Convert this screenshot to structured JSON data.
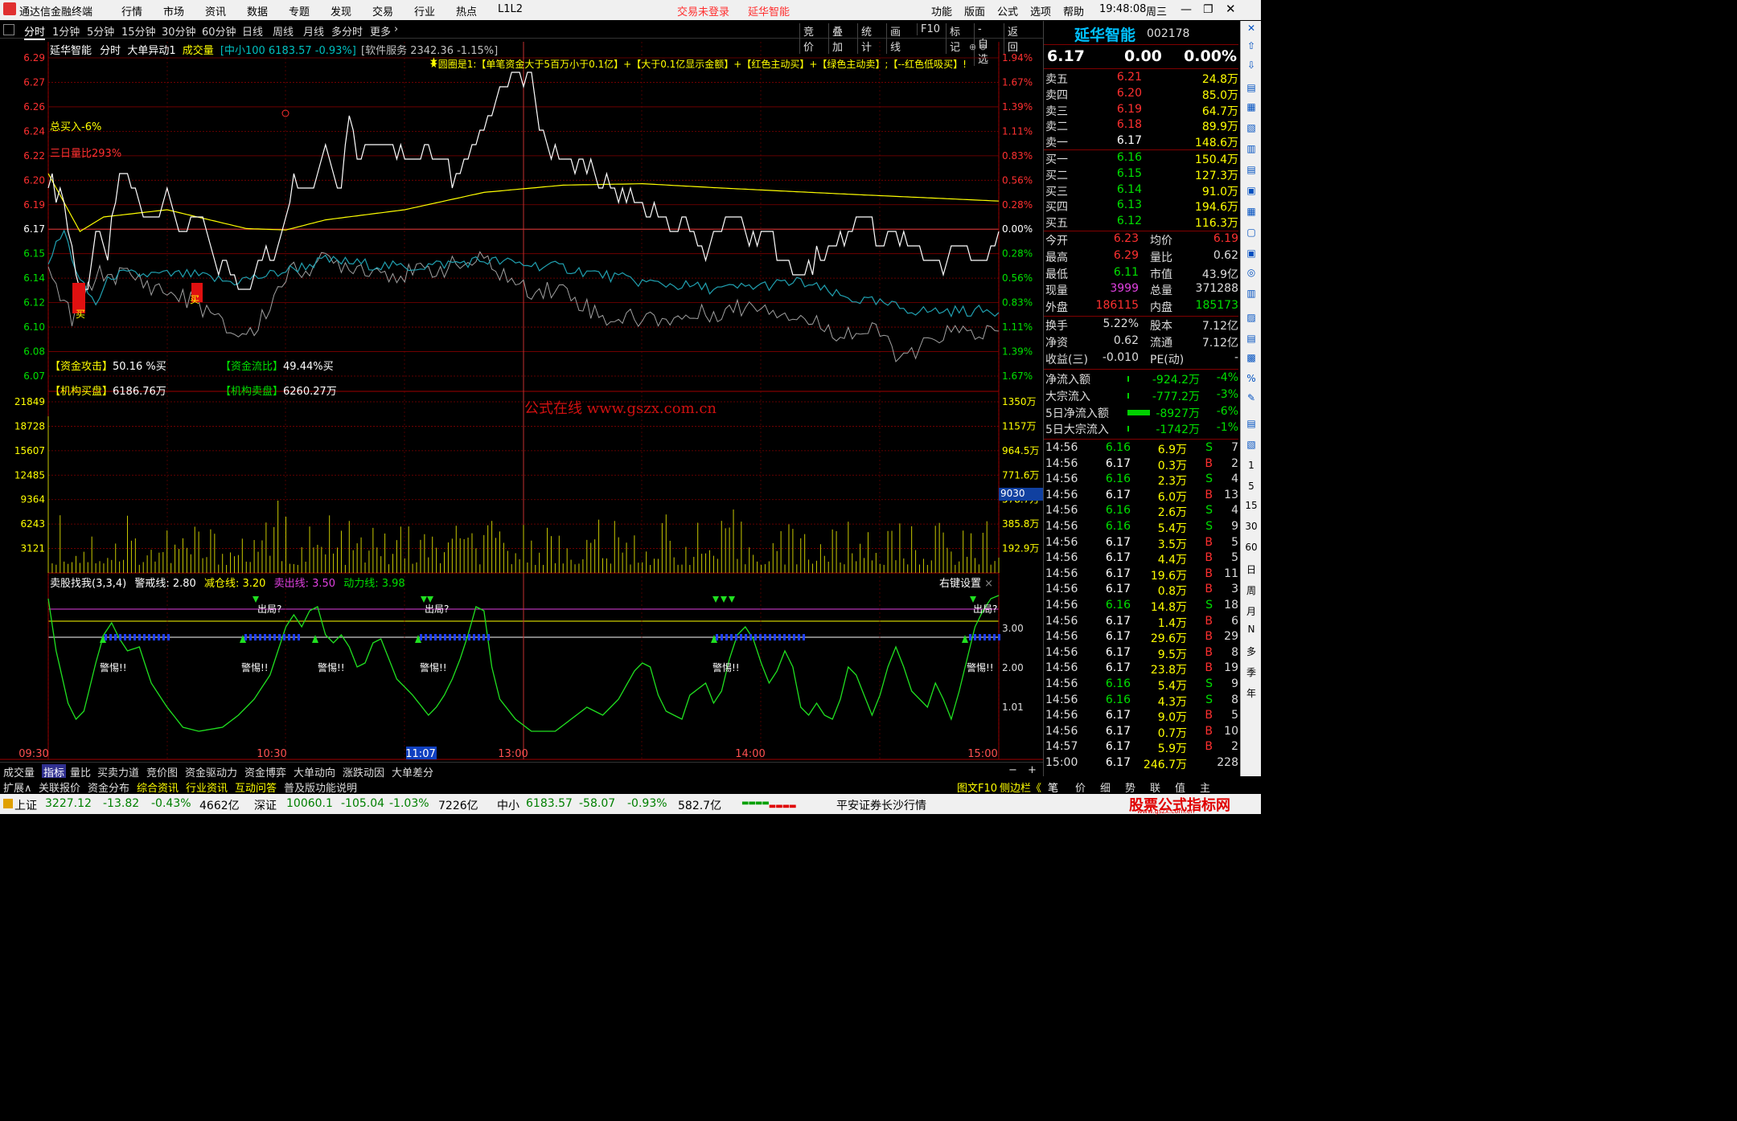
{
  "menu": {
    "app": "通达信金融终端",
    "items": [
      "行情",
      "市场",
      "资讯",
      "数据",
      "专题",
      "发现",
      "交易",
      "行业",
      "热点",
      "L1L2"
    ],
    "trade_status": "交易未登录",
    "stock_title": "延华智能",
    "right": [
      "功能",
      "版面",
      "公式",
      "选项",
      "帮助"
    ],
    "time": "19:48:08",
    "weekday": "周三"
  },
  "periods": [
    "分时",
    "1分钟",
    "5分钟",
    "15分钟",
    "30分钟",
    "60分钟",
    "日线",
    "周线",
    "月线",
    "多分时",
    "更多"
  ],
  "tools": [
    "竞价",
    "叠加",
    "统计",
    "画线",
    "F10",
    "标记",
    "-自选",
    "返回"
  ],
  "chart_head": {
    "name": "延华智能",
    "mode": "分时",
    "formula": "大单异动1",
    "vol": "成交量",
    "idx": "[中小100 6183.57 -0.93%]",
    "sw": "[软件服务 2342.36 -1.15%]"
  },
  "legend_text": "★圆圈是1:【单笔资金大于5百万小于0.1亿】+【大于0.1亿显示金额】+【红色主动买】+【绿色主动卖】;【--红色低吸买】!",
  "annot": {
    "total_buy": "总买入-6%",
    "vol_ratio": "三日量比293%",
    "attack_label": "【资金攻击】",
    "attack_val": "50.16 %买",
    "flow_label": "【资金流比】",
    "flow_val": "49.44%买",
    "inst_buy_label": "【机构买盘】",
    "inst_buy_val": "6186.76万",
    "inst_sell_label": "【机构卖盘】",
    "inst_sell_val": "6260.27万",
    "watermark": "公式在线  www.gszx.com.cn",
    "buy_mark": "买"
  },
  "price_left": [
    "6.29",
    "6.27",
    "6.26",
    "6.24",
    "6.22",
    "6.20",
    "6.19",
    "6.17",
    "6.15",
    "6.14",
    "6.12",
    "6.10",
    "6.08",
    "6.07"
  ],
  "pct_right": [
    "1.94%",
    "1.67%",
    "1.39%",
    "1.11%",
    "0.83%",
    "0.56%",
    "0.28%",
    "0.00%",
    "0.28%",
    "0.56%",
    "0.83%",
    "1.11%",
    "1.39%",
    "1.67%"
  ],
  "vol_left": [
    "21849",
    "18728",
    "15607",
    "12485",
    "9364",
    "6243",
    "3121"
  ],
  "vol_right": [
    "1350万",
    "1157万",
    "964.5万",
    "771.6万",
    "578.7万",
    "385.8万",
    "192.9万"
  ],
  "vol_cursor": "9030",
  "ind_head": {
    "name": "卖股找我(3,3,4)",
    "l1": "警戒线: 2.80",
    "l2": "减仓线: 3.20",
    "l3": "卖出线: 3.50",
    "l4": "动力线: 3.98",
    "set": "右键设置"
  },
  "ind_right": [
    "3.00",
    "2.00",
    "1.01"
  ],
  "ind_labels": {
    "out": "出局?",
    "warn": "警惕!!"
  },
  "times": [
    "09:30",
    "10:30",
    "11:07",
    "13:00",
    "14:00",
    "15:00"
  ],
  "quote": {
    "name": "延华智能",
    "code": "002178",
    "price": "6.17",
    "chg": "0.00",
    "pct": "0.00%"
  },
  "asks": [
    {
      "l": "卖五",
      "p": "6.21",
      "v": "24.8万"
    },
    {
      "l": "卖四",
      "p": "6.20",
      "v": "85.0万"
    },
    {
      "l": "卖三",
      "p": "6.19",
      "v": "64.7万"
    },
    {
      "l": "卖二",
      "p": "6.18",
      "v": "89.9万"
    },
    {
      "l": "卖一",
      "p": "6.17",
      "v": "148.6万"
    }
  ],
  "bids": [
    {
      "l": "买一",
      "p": "6.16",
      "v": "150.4万"
    },
    {
      "l": "买二",
      "p": "6.15",
      "v": "127.3万"
    },
    {
      "l": "买三",
      "p": "6.14",
      "v": "91.0万"
    },
    {
      "l": "买四",
      "p": "6.13",
      "v": "194.6万"
    },
    {
      "l": "买五",
      "p": "6.12",
      "v": "116.3万"
    }
  ],
  "stats": [
    {
      "a": "今开",
      "b": "6.23",
      "c": "均价",
      "d": "6.19"
    },
    {
      "a": "最高",
      "b": "6.29",
      "c": "量比",
      "d": "0.62"
    },
    {
      "a": "最低",
      "b": "6.11",
      "c": "市值",
      "d": "43.9亿"
    },
    {
      "a": "现量",
      "b": "3999",
      "c": "总量",
      "d": "371288"
    },
    {
      "a": "外盘",
      "b": "186115",
      "c": "内盘",
      "d": "185173"
    }
  ],
  "stats2": [
    {
      "a": "换手",
      "b": "5.22%",
      "c": "股本",
      "d": "7.12亿"
    },
    {
      "a": "净资",
      "b": "0.62",
      "c": "流通",
      "d": "7.12亿"
    },
    {
      "a": "收益(三)",
      "b": "-0.010",
      "c": "PE(动)",
      "d": "-"
    }
  ],
  "flows": [
    {
      "a": "净流入额",
      "b": "-924.2万",
      "c": "-4%"
    },
    {
      "a": "大宗流入",
      "b": "-777.2万",
      "c": "-3%"
    },
    {
      "a": "5日净流入额",
      "b": "-8927万",
      "c": "-6%"
    },
    {
      "a": "5日大宗流入",
      "b": "-1742万",
      "c": "-1%"
    }
  ],
  "ticks": [
    [
      "14:56",
      "6.16",
      "6.9万",
      "S",
      "7"
    ],
    [
      "14:56",
      "6.17",
      "0.3万",
      "B",
      "2"
    ],
    [
      "14:56",
      "6.16",
      "2.3万",
      "S",
      "4"
    ],
    [
      "14:56",
      "6.17",
      "6.0万",
      "B",
      "13"
    ],
    [
      "14:56",
      "6.16",
      "2.6万",
      "S",
      "4"
    ],
    [
      "14:56",
      "6.16",
      "5.4万",
      "S",
      "9"
    ],
    [
      "14:56",
      "6.17",
      "3.5万",
      "B",
      "5"
    ],
    [
      "14:56",
      "6.17",
      "4.4万",
      "B",
      "5"
    ],
    [
      "14:56",
      "6.17",
      "19.6万",
      "B",
      "11"
    ],
    [
      "14:56",
      "6.17",
      "0.8万",
      "B",
      "3"
    ],
    [
      "14:56",
      "6.16",
      "14.8万",
      "S",
      "18"
    ],
    [
      "14:56",
      "6.17",
      "1.4万",
      "B",
      "6"
    ],
    [
      "14:56",
      "6.17",
      "29.6万",
      "B",
      "29"
    ],
    [
      "14:56",
      "6.17",
      "9.5万",
      "B",
      "8"
    ],
    [
      "14:56",
      "6.17",
      "23.8万",
      "B",
      "19"
    ],
    [
      "14:56",
      "6.16",
      "5.4万",
      "S",
      "9"
    ],
    [
      "14:56",
      "6.16",
      "4.3万",
      "S",
      "8"
    ],
    [
      "14:56",
      "6.17",
      "9.0万",
      "B",
      "5"
    ],
    [
      "14:56",
      "6.17",
      "0.7万",
      "B",
      "10"
    ],
    [
      "14:57",
      "6.17",
      "5.9万",
      "B",
      "2"
    ],
    [
      "15:00",
      "6.17",
      "246.7万",
      "",
      "228"
    ]
  ],
  "sidebar": [
    "1",
    "5",
    "15",
    "30",
    "60",
    "日",
    "周",
    "月",
    "N",
    "多",
    "季",
    "年"
  ],
  "btabs": [
    "成交量",
    "指标",
    "量比",
    "买卖力道",
    "竞价图",
    "资金驱动力",
    "资金博弈",
    "大单动向",
    "涨跌动因",
    "大单差分"
  ],
  "btabs2": [
    "扩展∧",
    "关联报价",
    "资金分布",
    "综合资讯",
    "行业资讯",
    "互动问答",
    "普及版功能说明"
  ],
  "btabs2_right": [
    "图文F10",
    "侧边栏《",
    "笔",
    "价",
    "细",
    "势",
    "联",
    "值",
    "主"
  ],
  "status": {
    "sh": "上证",
    "sh_v": "3227.12",
    "sh_c": "-13.82",
    "sh_p": "-0.43%",
    "sh_a": "4662亿",
    "sz": "深证",
    "sz_v": "10060.1",
    "sz_c": "-105.04",
    "sz_p": "-1.03%",
    "sz_a": "7226亿",
    "zx": "中小",
    "zx_v": "6183.57",
    "zx_c": "-58.07",
    "zx_p": "-0.93%",
    "zx_a": "582.7亿",
    "broker": "平安证券长沙行情",
    "brand": "股票公式指标网",
    "url": "www.gszx.com.cn"
  },
  "colors": {
    "up": "#ff3030",
    "down": "#00e000",
    "price_line": "#ffffff",
    "avg_line": "#ffff00",
    "cyan_line": "#20a0b0",
    "gray_line": "#a0a0a0",
    "vol_bar": "#c8c800",
    "ind_line": "#20e020"
  }
}
